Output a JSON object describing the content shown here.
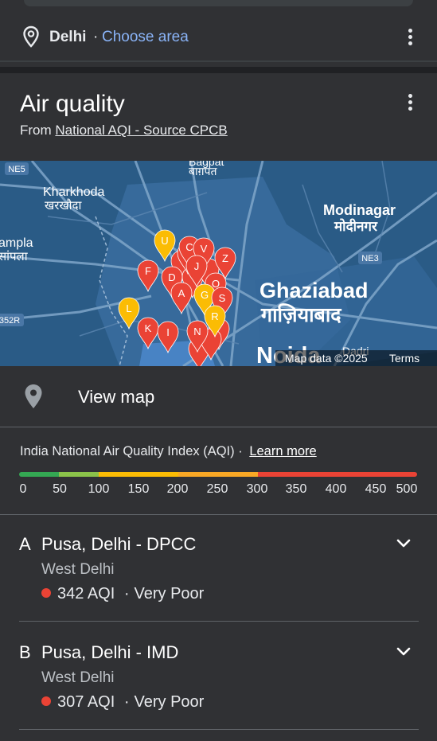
{
  "location": {
    "city": "Delhi",
    "separator": "·",
    "choose_area": "Choose area"
  },
  "card": {
    "title": "Air quality",
    "source_prefix": "From ",
    "source_link": "National AQI - Source CPCB"
  },
  "map": {
    "labels": {
      "kharkhoda": "Kharkhoda",
      "kharkhoda_hi": "खरखौदा",
      "baghpat_hi": "बाग़पत",
      "baghpat_partial": "Bagpat",
      "sampla": "ampla",
      "sampla_hi": "सांपला",
      "modinagar": "Modinagar",
      "modinagar_hi": "मोदीनगर",
      "ghaziabad": "Ghaziabad",
      "ghaziabad_hi": "गाज़ियाबाद",
      "noida": "Noida",
      "dadri": "Dadri",
      "ne5": "NE5",
      "ne3": "NE3",
      "r352": "352R",
      "map_data": "Map data ©2025",
      "terms": "Terms"
    },
    "markers": [
      {
        "letter": "U",
        "color": "#fbbc04"
      },
      {
        "letter": "C",
        "color": "#ea4335"
      },
      {
        "letter": "V",
        "color": "#ea4335"
      },
      {
        "letter": "Z",
        "color": "#ea4335"
      },
      {
        "letter": "F",
        "color": "#ea4335"
      },
      {
        "letter": "J",
        "color": "#ea4335"
      },
      {
        "letter": "D",
        "color": "#ea4335"
      },
      {
        "letter": "O",
        "color": "#ea4335"
      },
      {
        "letter": "A",
        "color": "#ea4335"
      },
      {
        "letter": "G",
        "color": "#fbbc04"
      },
      {
        "letter": "S",
        "color": "#ea4335"
      },
      {
        "letter": "L",
        "color": "#fbbc04"
      },
      {
        "letter": "R",
        "color": "#fbbc04"
      },
      {
        "letter": "K",
        "color": "#ea4335"
      },
      {
        "letter": "I",
        "color": "#ea4335"
      },
      {
        "letter": "N",
        "color": "#ea4335"
      }
    ]
  },
  "view_map": "View map",
  "aqi": {
    "title": "India National Air Quality Index (AQI)",
    "separator": "·",
    "learn_more": "Learn more",
    "scale_colors": [
      "#34a853",
      "#8bc34a",
      "#fbbc04",
      "#f9a825",
      "#ea4335"
    ],
    "ticks": [
      "0",
      "50",
      "100",
      "150",
      "200",
      "250",
      "300",
      "350",
      "400",
      "450",
      "500"
    ]
  },
  "stations": [
    {
      "letter": "A",
      "name": "Pusa, Delhi - DPCC",
      "area": "West Delhi",
      "aqi": "342 AQI",
      "sep": "·",
      "category": "Very Poor"
    },
    {
      "letter": "B",
      "name": "Pusa, Delhi - IMD",
      "area": "West Delhi",
      "aqi": "307 AQI",
      "sep": "·",
      "category": "Very Poor"
    }
  ]
}
